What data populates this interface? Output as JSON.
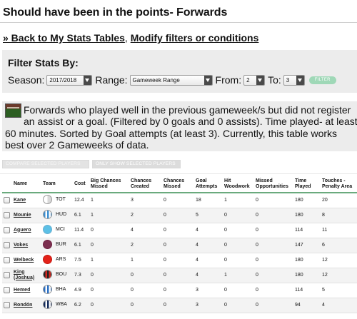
{
  "page": {
    "title": "Should have been in the points- Forwards"
  },
  "nav": {
    "back_label": "» Back to My Stats Tables",
    "separator": ",",
    "modify_label": "Modify filters or conditions"
  },
  "filters": {
    "heading": "Filter Stats By:",
    "season_label": "Season:",
    "season_value": "2017/2018",
    "range_label": "Range:",
    "range_value": "Gameweek Range",
    "from_label": "From:",
    "from_value": "2",
    "to_label": "To:",
    "to_value": "3",
    "filter_button": "FILTER"
  },
  "description": {
    "text": "Forwards who played well in the previous gameweek/s but did not register an assist or a goal. (Filtered by 0 goals and 0 assists). Time played- at least 60 minutes. Sorted by Goal attempts (at least 3). Currently, this table works best over 2 Gameweeks of data."
  },
  "actions": {
    "compare_label": "COMPARE SELECTED PLAYERS",
    "show_label": "ONLY SHOW SELECTED PLAYERS"
  },
  "table": {
    "headers": {
      "name": "Name",
      "team": "Team",
      "cost": "Cost",
      "big_chances_missed": "Big Chances Missed",
      "chances_created": "Chances Created",
      "chances_missed": "Chances Missed",
      "goal_attempts": "Goal Attempts",
      "hit_woodwork": "Hit Woodwork",
      "missed_opportunities": "Missed Opportunities",
      "time_played": "Time Played",
      "touches_penalty_area": "Touches - Penalty Area"
    },
    "rows": [
      {
        "name": "Kane",
        "team": "TOT",
        "team_icon": "tottenham-badge",
        "cost": "12.4",
        "bcm": "1",
        "cc": "3",
        "cm": "0",
        "ga": "18",
        "hw": "1",
        "mo": "0",
        "tp": "180",
        "tpa": "20"
      },
      {
        "name": "Mounie",
        "team": "HUD",
        "team_icon": "huddersfield-badge",
        "cost": "6.1",
        "bcm": "1",
        "cc": "2",
        "cm": "0",
        "ga": "5",
        "hw": "0",
        "mo": "0",
        "tp": "180",
        "tpa": "8"
      },
      {
        "name": "Aguero",
        "team": "MCI",
        "team_icon": "man-city-badge",
        "cost": "11.4",
        "bcm": "0",
        "cc": "4",
        "cm": "0",
        "ga": "4",
        "hw": "0",
        "mo": "0",
        "tp": "114",
        "tpa": "11"
      },
      {
        "name": "Vokes",
        "team": "BUR",
        "team_icon": "burnley-badge",
        "cost": "6.1",
        "bcm": "0",
        "cc": "2",
        "cm": "0",
        "ga": "4",
        "hw": "0",
        "mo": "0",
        "tp": "147",
        "tpa": "6"
      },
      {
        "name": "Welbeck",
        "team": "ARS",
        "team_icon": "arsenal-badge",
        "cost": "7.5",
        "bcm": "1",
        "cc": "1",
        "cm": "0",
        "ga": "4",
        "hw": "0",
        "mo": "0",
        "tp": "180",
        "tpa": "12"
      },
      {
        "name": "King (Joshua)",
        "team": "BOU",
        "team_icon": "bournemouth-badge",
        "cost": "7.3",
        "bcm": "0",
        "cc": "0",
        "cm": "0",
        "ga": "4",
        "hw": "1",
        "mo": "0",
        "tp": "180",
        "tpa": "12"
      },
      {
        "name": "Hemed",
        "team": "BHA",
        "team_icon": "brighton-badge",
        "cost": "4.9",
        "bcm": "0",
        "cc": "0",
        "cm": "0",
        "ga": "3",
        "hw": "0",
        "mo": "0",
        "tp": "114",
        "tpa": "5"
      },
      {
        "name": "Rondón",
        "team": "WBA",
        "team_icon": "west-brom-badge",
        "cost": "6.2",
        "bcm": "0",
        "cc": "0",
        "cm": "0",
        "ga": "3",
        "hw": "0",
        "mo": "0",
        "tp": "94",
        "tpa": "4"
      }
    ]
  },
  "colors": {
    "header_underline": "#6aaa7d",
    "filter_button": "#9fd8b7",
    "panel_bg": "#ececec"
  }
}
